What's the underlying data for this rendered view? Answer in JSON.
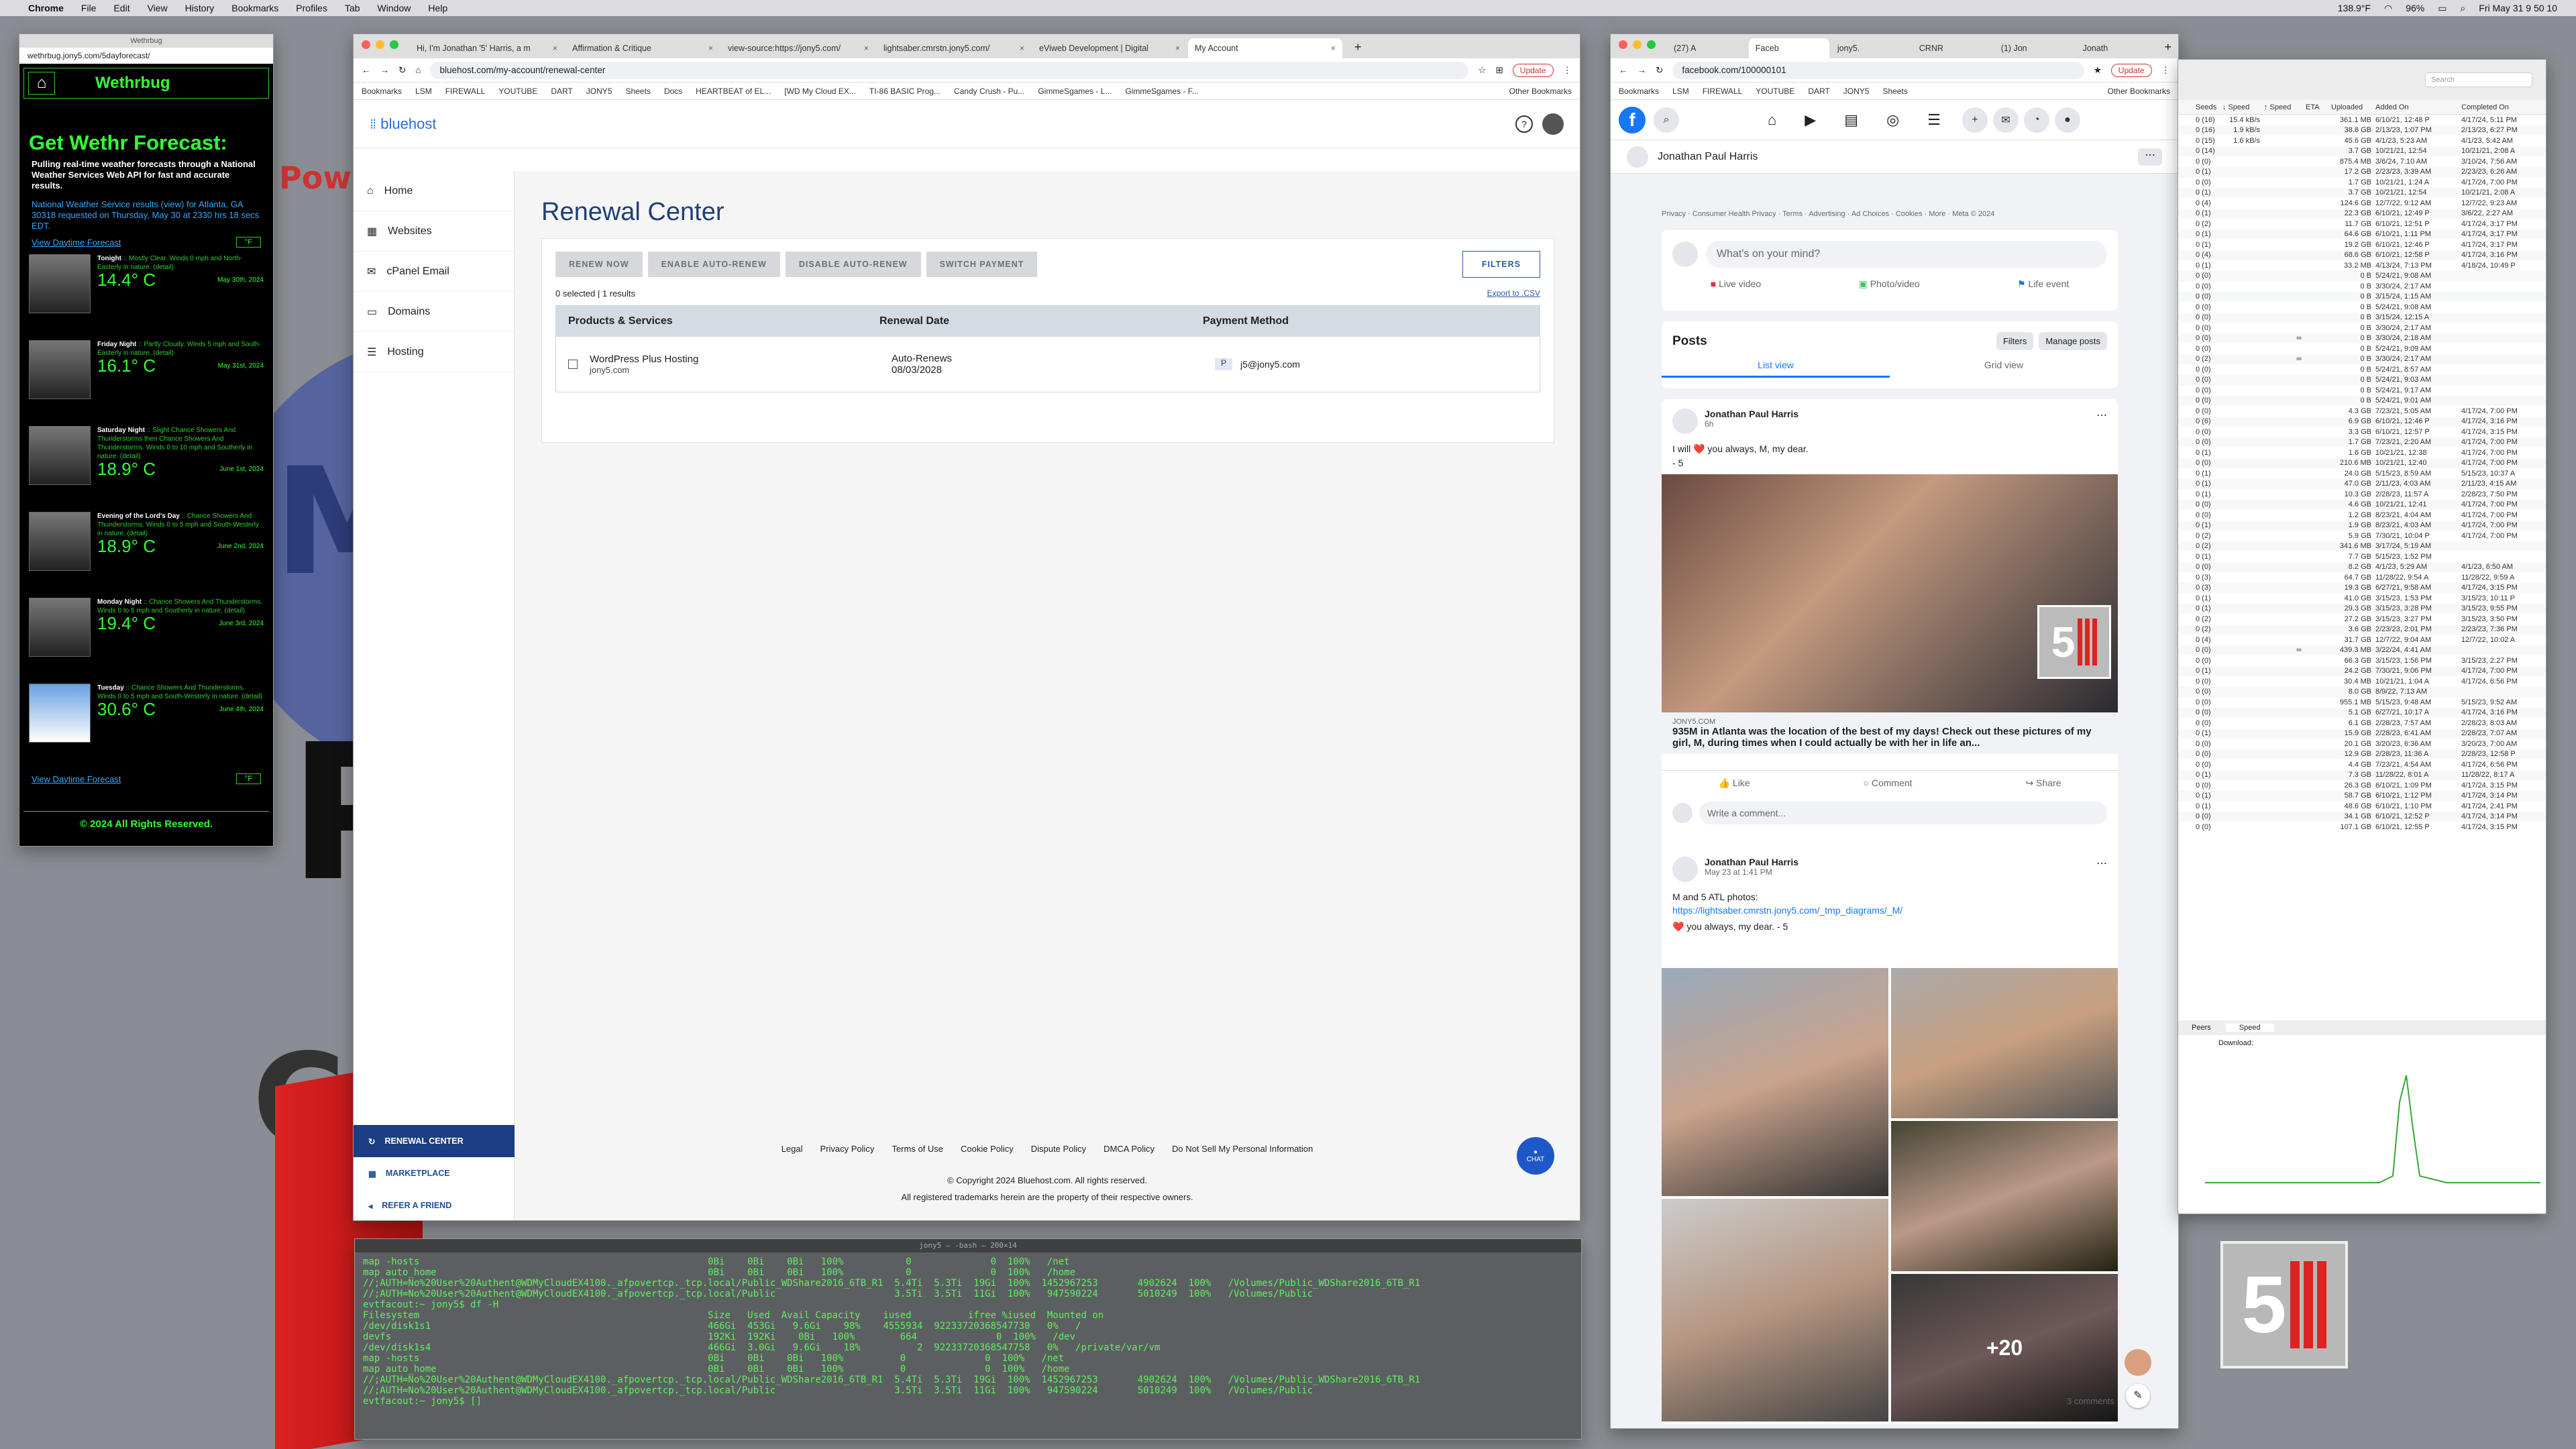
{
  "menubar": {
    "app": "Chrome",
    "items": [
      "File",
      "Edit",
      "View",
      "History",
      "Bookmarks",
      "Profiles",
      "Tab",
      "Window",
      "Help"
    ],
    "battery": "96%",
    "clock": "Fri May 31  9 50 10",
    "temp": "138.9°F"
  },
  "desktop": {
    "words": [
      "Powe",
      "My",
      "P",
      "CF"
    ]
  },
  "weather": {
    "title": "Wethrbug",
    "url": "wethrbug.jony5.com/5dayforecast/",
    "header": "Wethrbug",
    "heading": "Get Wethr Forecast:",
    "lead": "Pulling real-time weather forecasts through a National Weather Services Web API for fast and accurate results.",
    "desc": "National Weather Service results (view) for Atlanta, GA 30318 requested on Thursday, May 30 at 2330 hrs 18 secs EDT.",
    "daytime_link": "View Daytime Forecast",
    "unit_btn": "°F",
    "footer": "© 2024 All Rights Reserved.",
    "rows": [
      {
        "title": "Tonight",
        "text": "Mostly Clear. Winds 0 mph and North-Easterly in nature. (detail)",
        "temp": "14.4° C",
        "date": "May 30th, 2024"
      },
      {
        "title": "Friday Night",
        "text": "Partly Cloudy. Winds 5 mph and South-Easterly in nature. (detail)",
        "temp": "16.1° C",
        "date": "May 31st, 2024"
      },
      {
        "title": "Saturday Night",
        "text": "Slight Chance Showers And Thunderstorms then Chance Showers And Thunderstorms. Winds 0 to 10 mph and Southerly in nature. (detail)",
        "temp": "18.9° C",
        "date": "June 1st, 2024"
      },
      {
        "title": "Evening of the Lord's Day",
        "text": "Chance Showers And Thunderstorms. Winds 0 to 5 mph and South-Westerly in nature. (detail)",
        "temp": "18.9° C",
        "date": "June 2nd, 2024"
      },
      {
        "title": "Monday Night",
        "text": "Chance Showers And Thunderstorms. Winds 0 to 5 mph and Southerly in nature. (detail)",
        "temp": "19.4° C",
        "date": "June 3rd, 2024"
      },
      {
        "title": "Tuesday",
        "text": "Chance Showers And Thunderstorms. Winds 0 to 5 mph and South-Westerly in nature. (detail)",
        "temp": "30.6° C",
        "date": "June 4th, 2024"
      }
    ]
  },
  "bluehost": {
    "tabs": [
      "Hi, I'm Jonathan '5' Harris, a m",
      "Affirmation & Critique",
      "view-source:https://jony5.com/",
      "lightsaber.cmrstn.jony5.com/",
      "eViweb Development | Digital",
      "My Account"
    ],
    "url": "bluehost.com/my-account/renewal-center",
    "bookmarks": [
      "Bookmarks",
      "LSM",
      "FIREWALL",
      "YOUTUBE",
      "DART",
      "JONY5",
      "Sheets",
      "Docs",
      "HEARTBEAT of EL...",
      "[WD My Cloud EX...",
      "TI-86 BASIC Prog...",
      "Candy Crush - Pu...",
      "GimmeSgames - L...",
      "GimmeSgames - F...",
      "Other Bookmarks"
    ],
    "update": "Update",
    "logo": "bluehost",
    "nav": [
      "Home",
      "Websites",
      "cPanel Email",
      "Domains",
      "Hosting"
    ],
    "nav_bottom": [
      "RENEWAL CENTER",
      "MARKETPLACE",
      "REFER A FRIEND"
    ],
    "page_title": "Renewal Center",
    "buttons": [
      "RENEW NOW",
      "ENABLE AUTO-RENEW",
      "DISABLE AUTO-RENEW",
      "SWITCH PAYMENT"
    ],
    "filters": "FILTERS",
    "selected": "0 selected | 1 results",
    "export": "Export to .CSV",
    "columns": [
      "Products & Services",
      "Renewal Date",
      "Payment Method"
    ],
    "row": {
      "product": "WordPress Plus Hosting",
      "domain": "jony5.com",
      "status": "Auto-Renews",
      "date": "08/03/2028",
      "payment": "j5@jony5.com"
    },
    "footer_links": [
      "Legal",
      "Privacy Policy",
      "Terms of Use",
      "Cookie Policy",
      "Dispute Policy",
      "DMCA Policy",
      "Do Not Sell My Personal Information"
    ],
    "copyright": "© Copyright 2024 Bluehost.com. All rights reserved.",
    "trademark": "All registered trademarks herein are the property of their respective owners.",
    "chat": "CHAT"
  },
  "terminal": {
    "title": "jony5 — -bash — 200×14",
    "lines": [
      "map -hosts                                                   0Bi    0Bi    0Bi   100%           0              0  100%   /net",
      "map auto_home                                                0Bi    0Bi    0Bi   100%           0              0  100%   /home",
      "//;AUTH=No%20User%20Authent@WDMyCloudEX4100._afpovertcp._tcp.local/Public_WDShare2016_6TB_R1  5.4Ti  5.3Ti  19Gi  100%  1452967253       4902624  100%   /Volumes/Public_WDShare2016_6TB_R1",
      "//;AUTH=No%20User%20Authent@WDMyCloudEX4100._afpovertcp._tcp.local/Public                     3.5Ti  3.5Ti  11Gi  100%   947590224       5010249  100%   /Volumes/Public",
      "evtfacout:~ jony5$ df -H",
      "Filesystem                                                   Size   Used  Avail Capacity    iused          ifree %iused  Mounted on",
      "/dev/disk1s1                                                 466Gi  453Gi   9.6Gi    98%    4555934  92233720368547730   0%   /",
      "devfs                                                        192Ki  192Ki    0Bi   100%        664              0  100%   /dev",
      "/dev/disk1s4                                                 466Gi  3.0Gi   9.6Gi    18%          2  92233720368547758   0%   /private/var/vm",
      "map -hosts                                                   0Bi    0Bi    0Bi   100%          0              0  100%   /net",
      "map auto_home                                                0Bi    0Bi    0Bi   100%          0              0  100%   /home",
      "//;AUTH=No%20User%20Authent@WDMyCloudEX4100._afpovertcp._tcp.local/Public_WDShare2016_6TB_R1  5.4Ti  5.3Ti  19Gi  100%  1452967253       4902624  100%   /Volumes/Public_WDShare2016_6TB_R1",
      "//;AUTH=No%20User%20Authent@WDMyCloudEX4100._afpovertcp._tcp.local/Public                     3.5Ti  3.5Ti  11Gi  100%   947590224       5010249  100%   /Volumes/Public",
      "evtfacout:~ jony5$ []"
    ]
  },
  "facebook": {
    "tabs": [
      "(27) A",
      "Faceb",
      "jony5.",
      "CRNR",
      "(1) Jon",
      "Jonath"
    ],
    "url": "facebook.com/100000101",
    "bookmarks": [
      "Bookmarks",
      "LSM",
      "FIREWALL",
      "YOUTUBE",
      "DART",
      "JONY5",
      "Sheets",
      "Other Bookmarks"
    ],
    "update": "Update",
    "profile_name": "Jonathan Paul Harris",
    "footer": "Privacy · Consumer Health Privacy · Terms · Advertising · Ad Choices · Cookies · More · Meta © 2024",
    "composer": "What's on your mind?",
    "actions": [
      "Live video",
      "Photo/video",
      "Life event"
    ],
    "posts_title": "Posts",
    "filters": "Filters",
    "manage": "Manage posts",
    "views": [
      "List view",
      "Grid view"
    ],
    "post1": {
      "author": "Jonathan Paul Harris",
      "time": "6h",
      "text": "I will ❤️ you always, M, my dear.",
      "sig": "- 5",
      "domain": "JONY5.COM",
      "headline": "935M in Atlanta was the location of the best of my days! Check out these pictures of my girl, M, during times when I could actually be with her in life an...",
      "like": "Like",
      "comment": "Comment",
      "share": "Share",
      "write": "Write a comment..."
    },
    "post2": {
      "author": "Jonathan Paul Harris",
      "time": "May 23 at 1:41 PM",
      "text": "M and 5 ATL photos:",
      "link": "https://lightsaber.cmrstn.jony5.com/_tmp_diagrams/_M/",
      "sig": "❤️ you always, my dear. - 5",
      "more": "+20",
      "comments": "3 comments"
    }
  },
  "transmission": {
    "search": "Search",
    "columns": [
      "Seeds",
      "↓ Speed",
      "↑ Speed",
      "ETA",
      "Uploaded",
      "Added On",
      "Completed On"
    ],
    "rows": [
      [
        "0 (16)",
        "15.4 kB/s",
        "",
        "",
        "361.1 MB",
        "6/10/21, 12:48 P",
        "4/17/24, 5:11 PM"
      ],
      [
        "0 (16)",
        "1.9 kB/s",
        "",
        "",
        "38.8 GB",
        "2/13/23, 1:07 PM",
        "2/13/23, 6:27 PM"
      ],
      [
        "0 (15)",
        "1.6 kB/s",
        "",
        "",
        "45.6 GB",
        "4/1/23, 5:23 AM",
        "4/1/23, 5:42 AM"
      ],
      [
        "0 (14)",
        "",
        "",
        "",
        "3.7 GB",
        "10/21/21, 12:54",
        "10/21/21, 2:08 A"
      ],
      [
        "0 (0)",
        "",
        "",
        "",
        "875.4 MB",
        "3/6/24, 7:10 AM",
        "3/10/24, 7:56 AM"
      ],
      [
        "0 (1)",
        "",
        "",
        "",
        "17.2 GB",
        "2/23/23, 3:39 AM",
        "2/23/23, 6:26 AM"
      ],
      [
        "0 (0)",
        "",
        "",
        "",
        "1.7 GB",
        "10/21/21, 1:24 A",
        "4/17/24, 7:00 PM"
      ],
      [
        "0 (1)",
        "",
        "",
        "",
        "3.7 GB",
        "10/21/21, 12:54",
        "10/21/21, 2:08 A"
      ],
      [
        "0 (4)",
        "",
        "",
        "",
        "124.6 GB",
        "12/7/22, 9:12 AM",
        "12/7/22, 9:23 AM"
      ],
      [
        "0 (1)",
        "",
        "",
        "",
        "22.3 GB",
        "6/10/21, 12:49 P",
        "3/6/22, 2:27 AM"
      ],
      [
        "0 (2)",
        "",
        "",
        "",
        "11.7 GB",
        "6/10/21, 12:51 P",
        "4/17/24, 3:17 PM"
      ],
      [
        "0 (1)",
        "",
        "",
        "",
        "64.6 GB",
        "6/10/21, 1:11 PM",
        "4/17/24, 3:17 PM"
      ],
      [
        "0 (1)",
        "",
        "",
        "",
        "19.2 GB",
        "6/10/21, 12:46 P",
        "4/17/24, 3:17 PM"
      ],
      [
        "0 (4)",
        "",
        "",
        "",
        "68.6 GB",
        "6/10/21, 12:58 P",
        "4/17/24, 3:16 PM"
      ],
      [
        "0 (1)",
        "",
        "",
        "",
        "33.2 MB",
        "4/13/24, 7:13 PM",
        "4/18/24, 10:49 P"
      ],
      [
        "0 (0)",
        "",
        "",
        "",
        "0 B",
        "5/24/21, 9:08 AM",
        ""
      ],
      [
        "0 (0)",
        "",
        "",
        "",
        "0 B",
        "3/30/24, 2:17 AM",
        ""
      ],
      [
        "0 (0)",
        "",
        "",
        "",
        "0 B",
        "3/15/24, 1:15 AM",
        ""
      ],
      [
        "0 (0)",
        "",
        "",
        "",
        "0 B",
        "5/24/21, 9:08 AM",
        ""
      ],
      [
        "0 (0)",
        "",
        "",
        "",
        "0 B",
        "3/15/24, 12:15 A",
        ""
      ],
      [
        "0 (0)",
        "",
        "",
        "",
        "0 B",
        "3/30/24, 2:17 AM",
        ""
      ],
      [
        "0 (0)",
        "",
        "∞",
        "",
        "0 B",
        "3/30/24, 2:18 AM",
        ""
      ],
      [
        "0 (0)",
        "",
        "",
        "",
        "0 B",
        "5/24/21, 9:09 AM",
        ""
      ],
      [
        "0 (2)",
        "",
        "∞",
        "",
        "0 B",
        "3/30/24, 2:17 AM",
        ""
      ],
      [
        "0 (0)",
        "",
        "",
        "",
        "0 B",
        "5/24/21, 8:57 AM",
        ""
      ],
      [
        "0 (0)",
        "",
        "",
        "",
        "0 B",
        "5/24/21, 9:03 AM",
        ""
      ],
      [
        "0 (0)",
        "",
        "",
        "",
        "0 B",
        "5/24/21, 9:17 AM",
        ""
      ],
      [
        "0 (0)",
        "",
        "",
        "",
        "0 B",
        "5/24/21, 9:01 AM",
        ""
      ],
      [
        "0 (0)",
        "",
        "",
        "",
        "4.3 GB",
        "7/23/21, 5:05 AM",
        "4/17/24, 7:00 PM"
      ],
      [
        "0 (6)",
        "",
        "",
        "",
        "6.9 GB",
        "6/10/21, 12:46 P",
        "4/17/24, 3:16 PM"
      ],
      [
        "0 (0)",
        "",
        "",
        "",
        "3.3 GB",
        "6/10/21, 12:57 P",
        "4/17/24, 3:15 PM"
      ],
      [
        "0 (0)",
        "",
        "",
        "",
        "1.7 GB",
        "7/23/21, 2:20 AM",
        "4/17/24, 7:00 PM"
      ],
      [
        "0 (1)",
        "",
        "",
        "",
        "1.6 GB",
        "10/21/21, 12:38",
        "4/17/24, 7:00 PM"
      ],
      [
        "0 (0)",
        "",
        "",
        "",
        "210.6 MB",
        "10/21/21, 12:40",
        "4/17/24, 7:00 PM"
      ],
      [
        "0 (1)",
        "",
        "",
        "",
        "24.0 GB",
        "5/15/23, 8:59 AM",
        "5/15/23, 10:37 A"
      ],
      [
        "0 (1)",
        "",
        "",
        "",
        "47.0 GB",
        "2/11/23, 4:03 AM",
        "2/11/23, 4:15 AM"
      ],
      [
        "0 (1)",
        "",
        "",
        "",
        "10.3 GB",
        "2/28/23, 11:57 A",
        "2/28/23, 7:50 PM"
      ],
      [
        "0 (0)",
        "",
        "",
        "",
        "4.6 GB",
        "10/21/21, 12:41",
        "4/17/24, 7:00 PM"
      ],
      [
        "0 (0)",
        "",
        "",
        "",
        "1.2 GB",
        "8/23/21, 4:04 AM",
        "4/17/24, 7:00 PM"
      ],
      [
        "0 (1)",
        "",
        "",
        "",
        "1.9 GB",
        "8/23/21, 4:03 AM",
        "4/17/24, 7:00 PM"
      ],
      [
        "0 (2)",
        "",
        "",
        "",
        "5.9 GB",
        "7/30/21, 10:04 P",
        "4/17/24, 7:00 PM"
      ],
      [
        "0 (2)",
        "",
        "",
        "",
        "341.6 MB",
        "3/17/24, 5:19 AM",
        ""
      ],
      [
        "0 (1)",
        "",
        "",
        "",
        "7.7 GB",
        "5/15/23, 1:52 PM",
        ""
      ],
      [
        "0 (0)",
        "",
        "",
        "",
        "8.2 GB",
        "4/1/23, 5:29 AM",
        "4/1/23, 6:50 AM"
      ],
      [
        "0 (3)",
        "",
        "",
        "",
        "64.7 GB",
        "11/28/22, 9:54 A",
        "11/28/22, 9:59 A"
      ],
      [
        "0 (3)",
        "",
        "",
        "",
        "19.3 GB",
        "6/27/21, 9:58 AM",
        "4/17/24, 3:15 PM"
      ],
      [
        "0 (1)",
        "",
        "",
        "",
        "41.0 GB",
        "3/15/23, 1:53 PM",
        "3/15/23, 10:11 P"
      ],
      [
        "0 (1)",
        "",
        "",
        "",
        "29.3 GB",
        "3/15/23, 3:28 PM",
        "3/15/23, 9:55 PM"
      ],
      [
        "0 (2)",
        "",
        "",
        "",
        "27.2 GB",
        "3/15/23, 3:27 PM",
        "3/15/23, 3:50 PM"
      ],
      [
        "0 (2)",
        "",
        "",
        "",
        "3.6 GB",
        "2/23/23, 2:01 PM",
        "2/23/23, 7:36 PM"
      ],
      [
        "0 (4)",
        "",
        "",
        "",
        "31.7 GB",
        "12/7/22, 9:04 AM",
        "12/7/22, 10:02 A"
      ],
      [
        "0 (0)",
        "",
        "∞",
        "",
        "439.3 MB",
        "3/22/24, 4:41 AM",
        ""
      ],
      [
        "0 (0)",
        "",
        "",
        "",
        "66.3 GB",
        "3/15/23, 1:56 PM",
        "3/15/23, 2:27 PM"
      ],
      [
        "0 (1)",
        "",
        "",
        "",
        "24.2 GB",
        "7/30/21, 9:06 PM",
        "4/17/24, 7:00 PM"
      ],
      [
        "0 (0)",
        "",
        "",
        "",
        "30.4 MB",
        "10/21/21, 1:04 A",
        "4/17/24, 6:56 PM"
      ],
      [
        "0 (0)",
        "",
        "",
        "",
        "8.0 GB",
        "8/9/22, 7:13 AM",
        ""
      ],
      [
        "0 (0)",
        "",
        "",
        "",
        "955.1 MB",
        "5/15/23, 9:48 AM",
        "5/15/23, 9:52 AM"
      ],
      [
        "0 (0)",
        "",
        "",
        "",
        "5.1 GB",
        "6/27/21, 10:17 A",
        "4/17/24, 3:16 PM"
      ],
      [
        "0 (0)",
        "",
        "",
        "",
        "6.1 GB",
        "2/28/23, 7:57 AM",
        "2/28/23, 8:03 AM"
      ],
      [
        "0 (1)",
        "",
        "",
        "",
        "15.9 GB",
        "2/28/23, 6:41 AM",
        "2/28/23, 7:07 AM"
      ],
      [
        "0 (0)",
        "",
        "",
        "",
        "20.1 GB",
        "3/20/23, 6:36 AM",
        "3/20/23, 7:00 AM"
      ],
      [
        "0 (0)",
        "",
        "",
        "",
        "12.9 GB",
        "2/28/23, 11:36 A",
        "2/28/23, 12:58 P"
      ],
      [
        "0 (0)",
        "",
        "",
        "",
        "4.4 GB",
        "7/23/21, 4:54 AM",
        "4/17/24, 6:56 PM"
      ],
      [
        "0 (1)",
        "",
        "",
        "",
        "7.3 GB",
        "11/28/22, 8:01 A",
        "11/28/22, 8:17 A"
      ],
      [
        "0 (0)",
        "",
        "",
        "",
        "26.3 GB",
        "6/10/21, 1:09 PM",
        "4/17/24, 3:15 PM"
      ],
      [
        "0 (1)",
        "",
        "",
        "",
        "58.7 GB",
        "6/10/21, 1:12 PM",
        "4/17/24, 3:14 PM"
      ],
      [
        "0 (1)",
        "",
        "",
        "",
        "48.6 GB",
        "6/10/21, 1:10 PM",
        "4/17/24, 2:41 PM"
      ],
      [
        "0 (0)",
        "",
        "",
        "",
        "34.1 GB",
        "6/10/21, 12:52 P",
        "4/17/24, 3:14 PM"
      ],
      [
        "0 (0)",
        "",
        "",
        "",
        "107.1 GB",
        "6/10/21, 12:55 P",
        "4/17/24, 3:15 PM"
      ]
    ],
    "bottom_tabs": [
      "Peers",
      "Speed"
    ],
    "download_label": "Download:"
  }
}
